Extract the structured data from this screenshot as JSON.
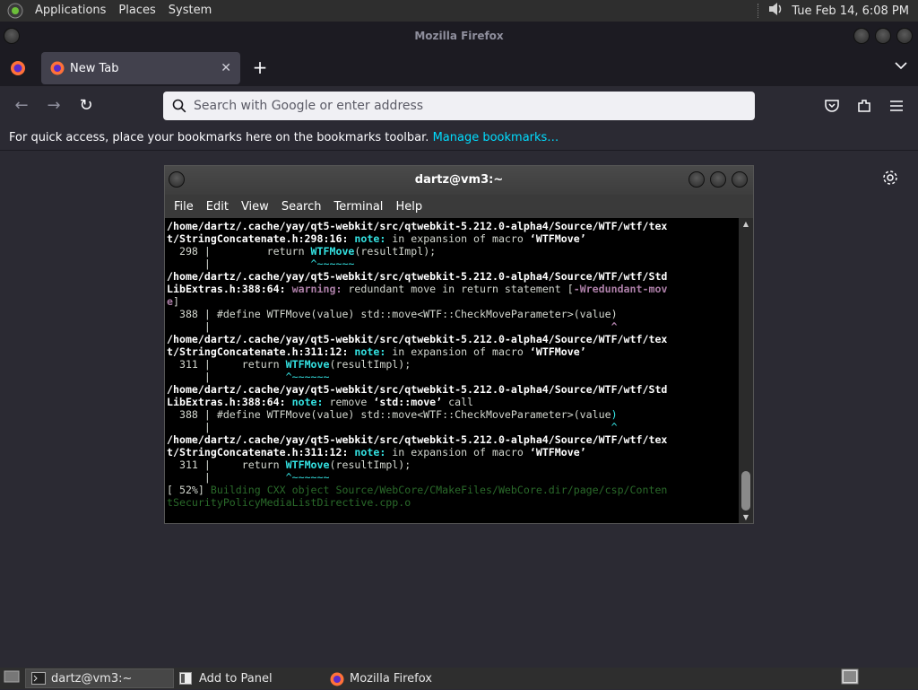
{
  "top_panel": {
    "menus": [
      "Applications",
      "Places",
      "System"
    ],
    "clock": "Tue Feb 14,  6:08 PM"
  },
  "firefox": {
    "window_title": "Mozilla Firefox",
    "tab_label": "New Tab",
    "url_placeholder": "Search with Google or enter address",
    "bookmarks_text": "For quick access, place your bookmarks here on the bookmarks toolbar.",
    "bookmarks_link": "Manage bookmarks…"
  },
  "terminal": {
    "title": "dartz@vm3:~",
    "menus": [
      "File",
      "Edit",
      "View",
      "Search",
      "Terminal",
      "Help"
    ],
    "lines": [
      [
        [
          "b",
          "/home/dartz/.cache/yay/qt5-webkit/src/qtwebkit-5.212.0-alpha4/Source/WTF/wtf/tex"
        ]
      ],
      [
        [
          "b",
          "t/StringConcatenate.h:298:16: "
        ],
        [
          "cy",
          "note:"
        ],
        [
          "n",
          " in expansion of macro "
        ],
        [
          "b",
          "‘WTFMove’"
        ]
      ],
      [
        [
          "n",
          "  298 |         return "
        ],
        [
          "cy",
          "WTFMove"
        ],
        [
          "n",
          "(resultImpl);"
        ]
      ],
      [
        [
          "n",
          "      |                "
        ],
        [
          "cyt",
          "^~~~~~~"
        ]
      ],
      [
        [
          "b",
          "/home/dartz/.cache/yay/qt5-webkit/src/qtwebkit-5.212.0-alpha4/Source/WTF/wtf/Std"
        ]
      ],
      [
        [
          "b",
          "LibExtras.h:388:64: "
        ],
        [
          "mg",
          "warning:"
        ],
        [
          "n",
          " redundant move in return statement ["
        ],
        [
          "mg",
          "-Wredundant-mov"
        ]
      ],
      [
        [
          "mg",
          "e"
        ],
        [
          "n",
          "]"
        ]
      ],
      [
        [
          "n",
          "  388 | #define WTFMove(value) std::move<WTF::CheckMoveParameter>(value)"
        ]
      ],
      [
        [
          "n",
          "      |                                                                "
        ],
        [
          "mg",
          "^"
        ]
      ],
      [
        [
          "b",
          "/home/dartz/.cache/yay/qt5-webkit/src/qtwebkit-5.212.0-alpha4/Source/WTF/wtf/tex"
        ]
      ],
      [
        [
          "b",
          "t/StringConcatenate.h:311:12: "
        ],
        [
          "cy",
          "note:"
        ],
        [
          "n",
          " in expansion of macro "
        ],
        [
          "b",
          "‘WTFMove’"
        ]
      ],
      [
        [
          "n",
          "  311 |     return "
        ],
        [
          "cy",
          "WTFMove"
        ],
        [
          "n",
          "(resultImpl);"
        ]
      ],
      [
        [
          "n",
          "      |            "
        ],
        [
          "cyt",
          "^~~~~~~"
        ]
      ],
      [
        [
          "b",
          "/home/dartz/.cache/yay/qt5-webkit/src/qtwebkit-5.212.0-alpha4/Source/WTF/wtf/Std"
        ]
      ],
      [
        [
          "b",
          "LibExtras.h:388:64: "
        ],
        [
          "cy",
          "note:"
        ],
        [
          "n",
          " remove "
        ],
        [
          "b",
          "‘std::move’"
        ],
        [
          "n",
          " call"
        ]
      ],
      [
        [
          "n",
          "  388 | #define WTFMove(value) std::move<WTF::CheckMoveParameter>(value"
        ],
        [
          "cyt",
          ")"
        ]
      ],
      [
        [
          "n",
          "      |                                                                "
        ],
        [
          "cyt",
          "^"
        ]
      ],
      [
        [
          "b",
          "/home/dartz/.cache/yay/qt5-webkit/src/qtwebkit-5.212.0-alpha4/Source/WTF/wtf/tex"
        ]
      ],
      [
        [
          "b",
          "t/StringConcatenate.h:311:12: "
        ],
        [
          "cy",
          "note:"
        ],
        [
          "n",
          " in expansion of macro "
        ],
        [
          "b",
          "‘WTFMove’"
        ]
      ],
      [
        [
          "n",
          "  311 |     return "
        ],
        [
          "cy",
          "WTFMove"
        ],
        [
          "n",
          "(resultImpl);"
        ]
      ],
      [
        [
          "n",
          "      |            "
        ],
        [
          "cyt",
          "^~~~~~~"
        ]
      ],
      [
        [
          "n",
          "[ 52%] "
        ],
        [
          "gr",
          "Building CXX object Source/WebCore/CMakeFiles/WebCore.dir/page/csp/Conten"
        ]
      ],
      [
        [
          "gr",
          "tSecurityPolicyMediaListDirective.cpp.o"
        ]
      ]
    ]
  },
  "taskbar": {
    "items": [
      "dartz@vm3:~",
      "Add to Panel",
      "Mozilla Firefox"
    ]
  },
  "colors": {
    "firefox_dark": "#1c1b22",
    "toolbar": "#2b2a33",
    "link": "#00ddff",
    "note": "#34e2e2",
    "warning": "#ad7fa8"
  }
}
